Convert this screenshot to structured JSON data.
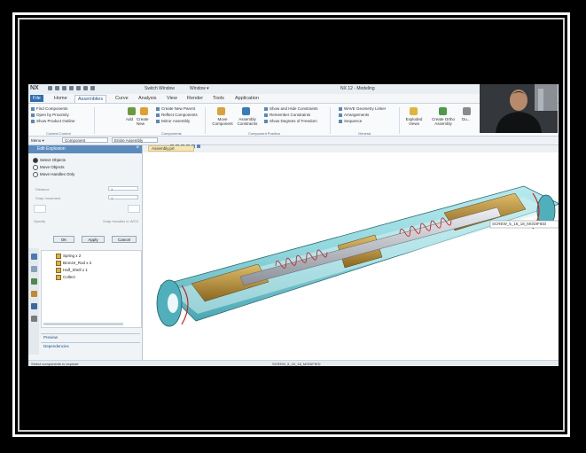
{
  "window": {
    "app_logo": "NX",
    "switch_window": "Switch Window",
    "window_menu": "Window ▾",
    "title": "NX 12 - Modeling"
  },
  "menubar": {
    "items": [
      "File",
      "Home",
      "Assemblies",
      "Curve",
      "Analysis",
      "View",
      "Render",
      "Tools",
      "Application"
    ]
  },
  "ribbon": {
    "left_items": [
      "Find Components",
      "Open by Proximity",
      "Show Product Outline"
    ],
    "context_control_label": "Context Control",
    "add_label": "Add",
    "create_new_label": "Create New",
    "component_items": [
      "Create New Parent",
      "Reflect Components",
      "Mirror Assembly"
    ],
    "components_label": "Components",
    "move_component_label": "Move Component",
    "assembly_constraints_label": "Assembly Constraints",
    "position_items": [
      "Show and Hide Constraints",
      "Remember Constraints",
      "Show Degrees of Freedom"
    ],
    "component_position_label": "Component Position",
    "general_items": [
      "WAVE Geometry Linker",
      "Arrangements",
      "Sequence"
    ],
    "general_label": "General",
    "exploded_views_label": "Exploded Views",
    "create_ortho_label": "Create Ortho Assembly",
    "last_label": "Du..."
  },
  "selection_bar": {
    "menu_label": "Menu ▾",
    "filter_value": "Component",
    "scope_value": "Entire Assembly"
  },
  "viewport_tab": {
    "label": "Assembly.prt"
  },
  "dialog": {
    "title": "Edit Explosion",
    "options": [
      "Select Objects",
      "Move Objects",
      "Move Handles Only"
    ],
    "selected_index": 0,
    "distance_label": "Distance",
    "distance_value": "1",
    "snap_label": "Snap Increment",
    "snap_value": "1",
    "left_option": "Specify",
    "right_option": "Snap Handles to WCS",
    "ok_label": "OK",
    "apply_label": "Apply",
    "cancel_label": "Cancel"
  },
  "tree": {
    "rows": [
      "Spring x 2",
      "Bronze_Rod x 2",
      "Half_Shell x 1",
      "Collect"
    ]
  },
  "panes": {
    "preview": "Preview",
    "dependencies": "Dependencies"
  },
  "status": {
    "left": "Select components to explode",
    "center": "SCREW_5_16_18_MODIFIED"
  },
  "model": {
    "callout": "SCREW_5_16_18_MODIFIED"
  },
  "colors": {
    "accent": "#2f6fb0",
    "dialog_header": "#5b8bbd",
    "housing": "#8fd6dd",
    "screw": "#c2c6cc",
    "bronze": "#b5892f",
    "spring_red": "#cc2222"
  }
}
